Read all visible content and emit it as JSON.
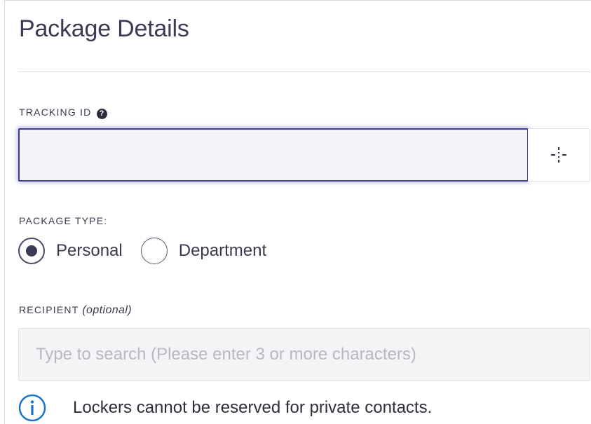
{
  "panel": {
    "title": "Package Details"
  },
  "tracking": {
    "label": "TRACKING ID",
    "help_icon": "question-circle-icon",
    "help_glyph": "?",
    "value": "",
    "placeholder": "",
    "scan_icon": "crosshair-scan-icon"
  },
  "package_type": {
    "label": "PACKAGE TYPE:",
    "options": [
      {
        "label": "Personal",
        "selected": true
      },
      {
        "label": "Department",
        "selected": false
      }
    ]
  },
  "recipient": {
    "label": "RECIPIENT",
    "optional_note": "(optional)",
    "value": "",
    "placeholder": "Type to search (Please enter 3 or more characters)"
  },
  "info": {
    "icon": "info-circle-icon",
    "message": "Lockers cannot be reserved for private contacts."
  },
  "colors": {
    "accent": "#3c3c8c",
    "info_blue": "#1a73c8",
    "text": "#3a3a4d"
  }
}
